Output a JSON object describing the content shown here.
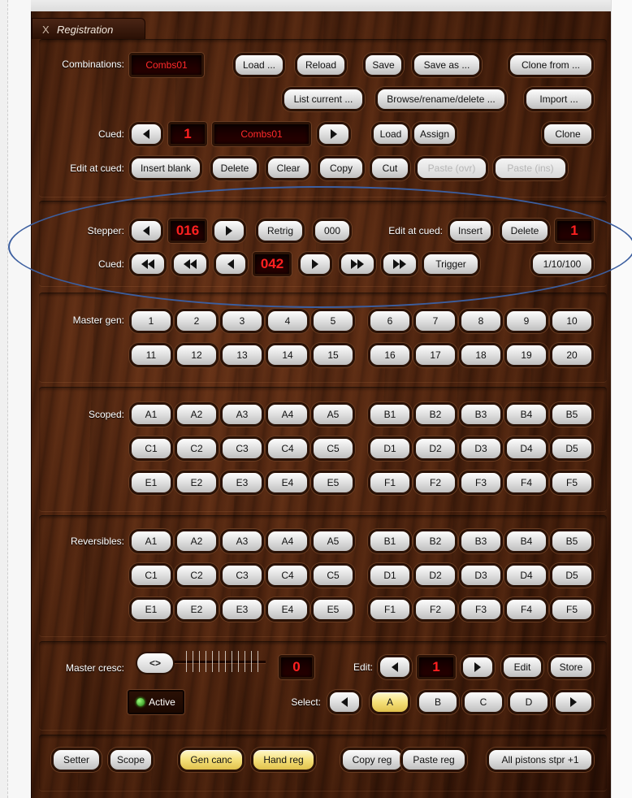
{
  "window": {
    "close_glyph": "X",
    "title": "Registration"
  },
  "combinations": {
    "label": "Combinations:",
    "current_file": "Combs01",
    "load": "Load ...",
    "reload": "Reload",
    "save": "Save",
    "save_as": "Save as ...",
    "clone_from": "Clone from ...",
    "list_current": "List current ...",
    "browse": "Browse/rename/delete ...",
    "import": "Import ..."
  },
  "cued": {
    "label": "Cued:",
    "number": "1",
    "file": "Combs01",
    "load": "Load",
    "assign": "Assign",
    "clone": "Clone"
  },
  "edit_at_cued": {
    "label": "Edit at cued:",
    "insert_blank": "Insert blank",
    "delete": "Delete",
    "clear": "Clear",
    "copy": "Copy",
    "cut": "Cut",
    "paste_ovr": "Paste (ovr)",
    "paste_ins": "Paste (ins)"
  },
  "stepper": {
    "label": "Stepper:",
    "value": "016",
    "retrig": "Retrig",
    "zero": "000",
    "edit_label": "Edit at cued:",
    "insert": "Insert",
    "delete": "Delete",
    "edit_value": "1",
    "cued_label": "Cued:",
    "cued_value": "042",
    "trigger": "Trigger",
    "step": "1/10/100"
  },
  "master_gen": {
    "label": "Master gen:",
    "buttons": [
      "1",
      "2",
      "3",
      "4",
      "5",
      "6",
      "7",
      "8",
      "9",
      "10",
      "11",
      "12",
      "13",
      "14",
      "15",
      "16",
      "17",
      "18",
      "19",
      "20"
    ]
  },
  "scoped": {
    "label": "Scoped:",
    "buttons": [
      "A1",
      "A2",
      "A3",
      "A4",
      "A5",
      "B1",
      "B2",
      "B3",
      "B4",
      "B5",
      "C1",
      "C2",
      "C3",
      "C4",
      "C5",
      "D1",
      "D2",
      "D3",
      "D4",
      "D5",
      "E1",
      "E2",
      "E3",
      "E4",
      "E5",
      "F1",
      "F2",
      "F3",
      "F4",
      "F5"
    ]
  },
  "reversibles": {
    "label": "Reversibles:",
    "buttons": [
      "A1",
      "A2",
      "A3",
      "A4",
      "A5",
      "B1",
      "B2",
      "B3",
      "B4",
      "B5",
      "C1",
      "C2",
      "C3",
      "C4",
      "C5",
      "D1",
      "D2",
      "D3",
      "D4",
      "D5",
      "E1",
      "E2",
      "E3",
      "E4",
      "E5",
      "F1",
      "F2",
      "F3",
      "F4",
      "F5"
    ]
  },
  "master_cresc": {
    "label": "Master cresc:",
    "knob": "<>",
    "value": "0",
    "active": "Active",
    "edit_label": "Edit:",
    "edit_value": "1",
    "edit": "Edit",
    "store": "Store",
    "select_label": "Select:",
    "select_options": [
      "A",
      "B",
      "C",
      "D"
    ],
    "selected": "A"
  },
  "bottom": {
    "setter": "Setter",
    "scope": "Scope",
    "gen_canc": "Gen canc",
    "hand_reg": "Hand reg",
    "copy_reg": "Copy reg",
    "paste_reg": "Paste reg",
    "all_pistons": "All pistons stpr +1"
  },
  "colors": {
    "wood": "#4a2210",
    "display_text": "#ff2020",
    "toggle_on": "#f5e07a",
    "annotation_oval": "#3c5fa0"
  }
}
